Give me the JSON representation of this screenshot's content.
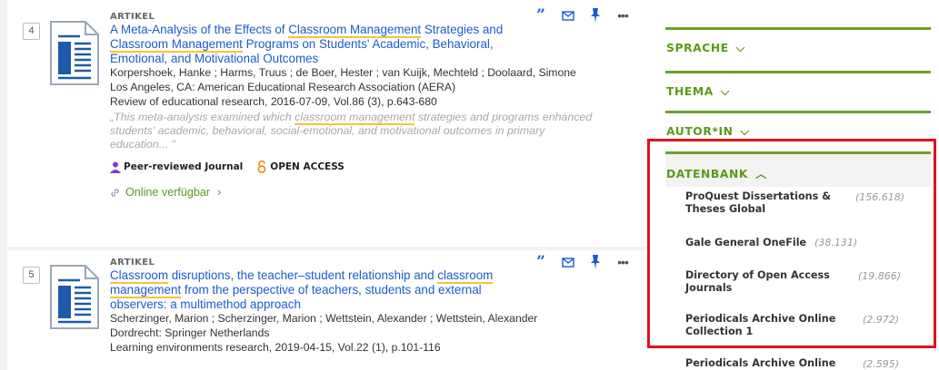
{
  "results": [
    {
      "number": "4",
      "type": "ARTIKEL",
      "title_parts": [
        "A Meta-Analysis of the Effects of ",
        "Classroom Management",
        " Strategies and ",
        "Classroom Management",
        " Programs on Students' Academic, Behavioral, Emotional, and Motivational Outcomes"
      ],
      "authors": "Korpershoek, Hanke ; Harms, Truus ; de Boer, Hester ; van Kuijk, Mechteld ; Doolaard, Simone",
      "publisher": "Los Angeles, CA: American Educational Research Association (AERA)",
      "source": "Review of educational research, 2016-07-09, Vol.86 (3), p.643-680",
      "snippet_parts": [
        "„This meta-analysis examined which ",
        "classroom management",
        " strategies and programs enhanced students' academic, behavioral, social-emotional, and motivational outcomes in primary education... \""
      ],
      "badge_peer": "Peer-reviewed Journal",
      "badge_oa": "OPEN ACCESS",
      "online_label": "Online verfügbar"
    },
    {
      "number": "5",
      "type": "ARTIKEL",
      "title_parts": [
        "Classroom",
        " disruptions, the teacher–student relationship and ",
        "classroom management",
        " from the perspective of teachers, students and external observers: a multimethod approach"
      ],
      "authors": "Scherzinger, Marion ; Scherzinger, Marion ; Wettstein, Alexander ; Wettstein, Alexander",
      "publisher": "Dordrecht: Springer Netherlands",
      "source": "Learning environments research, 2019-04-15, Vol.22 (1), p.101-116"
    }
  ],
  "facets": {
    "sprache": "SPRACHE",
    "thema": "THEMA",
    "autor": "AUTOR*IN",
    "datenbank": "DATENBANK",
    "datenbank_items": [
      {
        "label_line1": "ProQuest Dissertations &",
        "label_line2": "Theses Global",
        "count": "(156.618)"
      },
      {
        "label_line1": "Gale General OneFile",
        "label_line2": "",
        "count": "(38.131)"
      },
      {
        "label_line1": "Directory of Open Access",
        "label_line2": "Journals",
        "count": "(19.866)"
      },
      {
        "label_line1": "Periodicals Archive Online",
        "label_line2": "Collection 1",
        "count": "(2.972)"
      },
      {
        "label_line1": "Periodicals Archive Online",
        "label_line2": "",
        "count": "(2.595)"
      }
    ]
  },
  "colors": {
    "accent_green": "#6aa02e",
    "link_blue": "#1a5bd1",
    "highlight_red": "#e2121e"
  }
}
